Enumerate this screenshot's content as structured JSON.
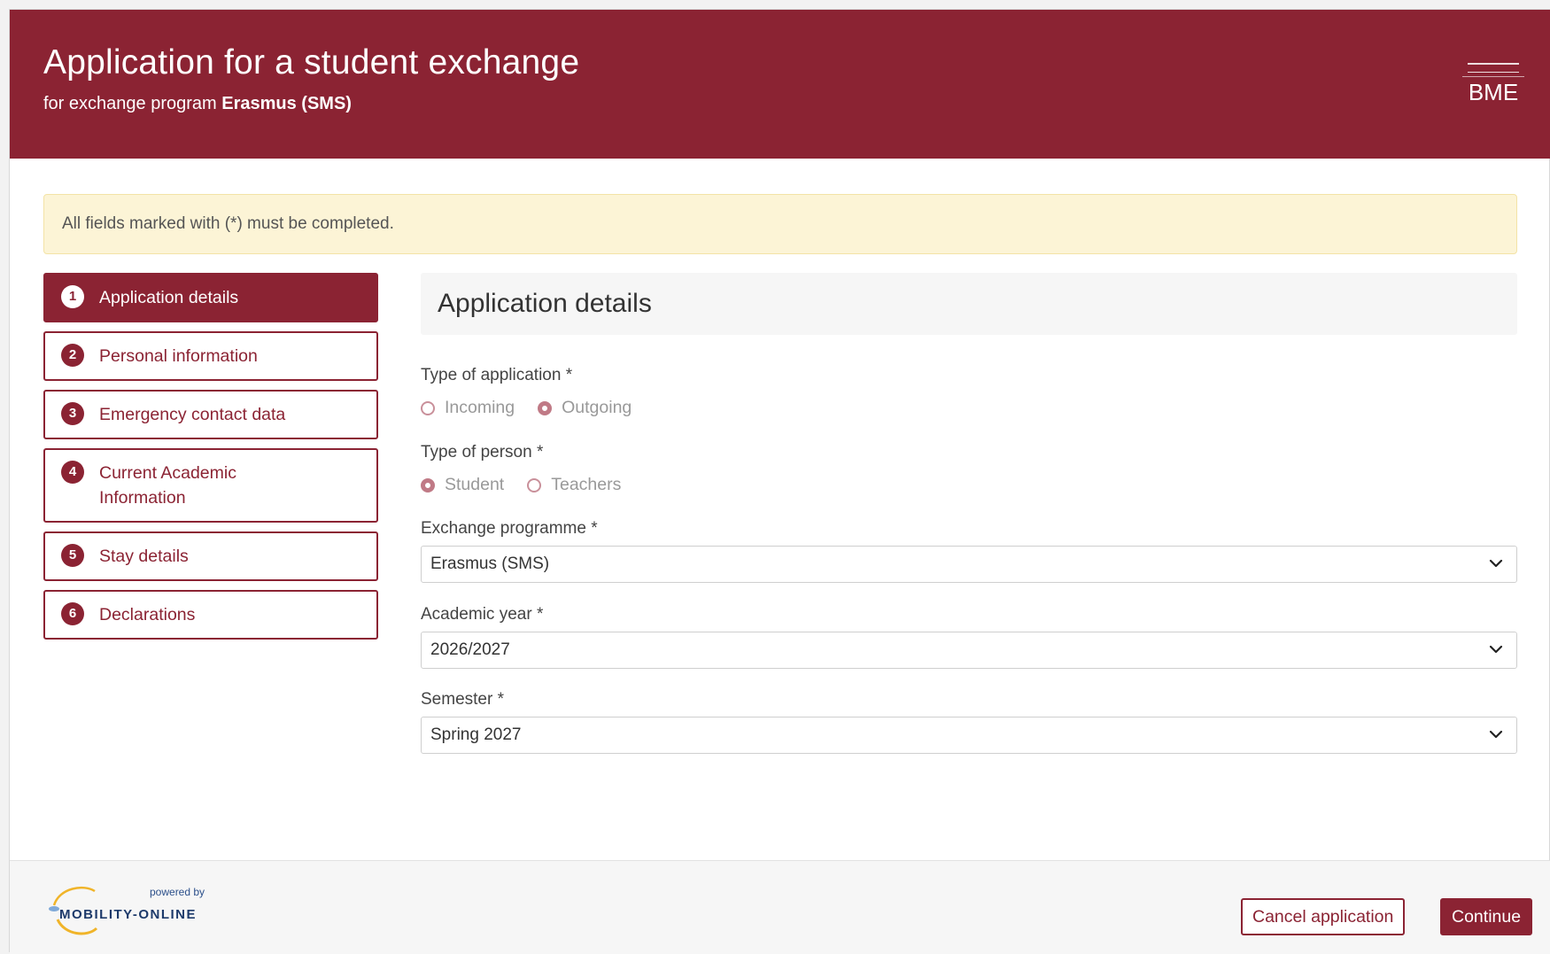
{
  "header": {
    "title": "Application for a student exchange",
    "subtitle_prefix": "for exchange program",
    "subtitle_program": "Erasmus (SMS)",
    "logo_text": "BME"
  },
  "alert": {
    "text": "All fields marked with (*) must be completed."
  },
  "steps": [
    {
      "num": "1",
      "label": "Application details",
      "active": true
    },
    {
      "num": "2",
      "label": "Personal information"
    },
    {
      "num": "3",
      "label": "Emergency contact data"
    },
    {
      "num": "4",
      "label": "Current Academic Information"
    },
    {
      "num": "5",
      "label": "Stay details"
    },
    {
      "num": "6",
      "label": "Declarations"
    }
  ],
  "panel": {
    "title": "Application details"
  },
  "form": {
    "type_of_application": {
      "label": "Type of application *",
      "options": [
        "Incoming",
        "Outgoing"
      ],
      "selected": "Outgoing"
    },
    "type_of_person": {
      "label": "Type of person *",
      "options": [
        "Student",
        "Teachers"
      ],
      "selected": "Student"
    },
    "exchange_programme": {
      "label": "Exchange programme *",
      "value": "Erasmus (SMS)"
    },
    "academic_year": {
      "label": "Academic year *",
      "value": "2026/2027"
    },
    "semester": {
      "label": "Semester *",
      "value": "Spring 2027"
    }
  },
  "footer": {
    "powered_by": "powered by",
    "brand": "MOBILITY-ONLINE",
    "cancel_label": "Cancel application",
    "continue_label": "Continue"
  },
  "colors": {
    "brand": "#8b2333",
    "alert_bg": "#fcf4d6"
  }
}
